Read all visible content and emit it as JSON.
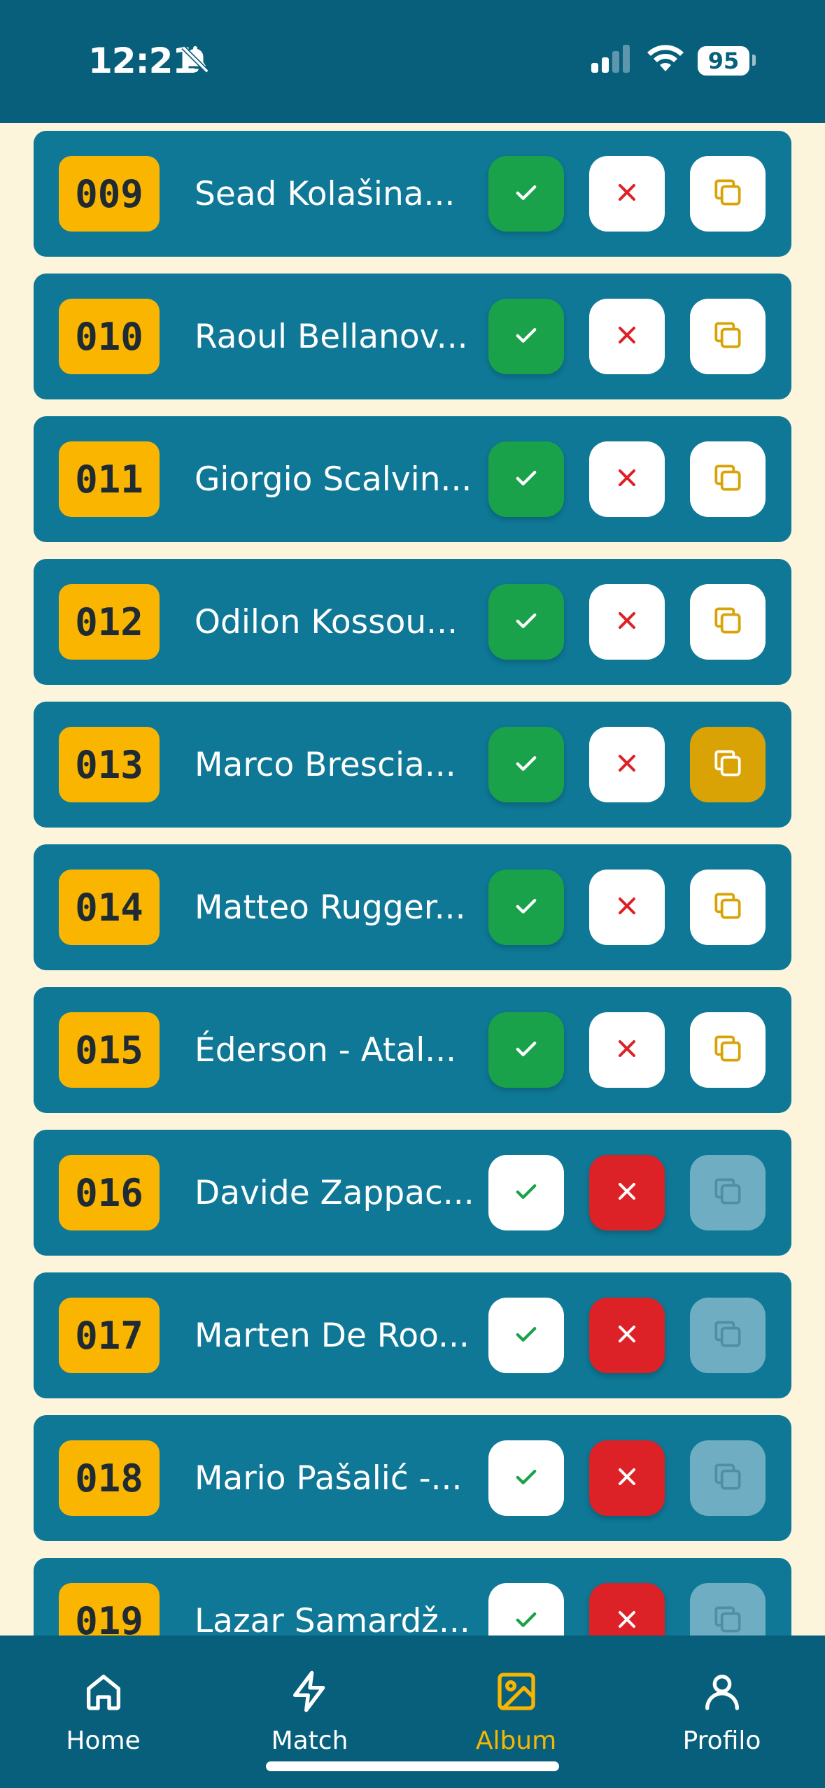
{
  "status_bar": {
    "time": "12:21",
    "battery": "95"
  },
  "stickers": [
    {
      "number": "009",
      "name": "Sead Kolašina...",
      "owned": true,
      "missing": false,
      "duplicate": "off"
    },
    {
      "number": "010",
      "name": "Raoul Bellanov...",
      "owned": true,
      "missing": false,
      "duplicate": "off"
    },
    {
      "number": "011",
      "name": "Giorgio Scalvin...",
      "owned": true,
      "missing": false,
      "duplicate": "off"
    },
    {
      "number": "012",
      "name": "Odilon Kossou...",
      "owned": true,
      "missing": false,
      "duplicate": "off"
    },
    {
      "number": "013",
      "name": "Marco Brescia...",
      "owned": true,
      "missing": false,
      "duplicate": "on"
    },
    {
      "number": "014",
      "name": "Matteo Rugger...",
      "owned": true,
      "missing": false,
      "duplicate": "off"
    },
    {
      "number": "015",
      "name": "Éderson - Atal...",
      "owned": true,
      "missing": false,
      "duplicate": "off"
    },
    {
      "number": "016",
      "name": "Davide Zappac...",
      "owned": false,
      "missing": true,
      "duplicate": "disabled"
    },
    {
      "number": "017",
      "name": "Marten De Roo...",
      "owned": false,
      "missing": true,
      "duplicate": "disabled"
    },
    {
      "number": "018",
      "name": "Mario Pašalić -...",
      "owned": false,
      "missing": true,
      "duplicate": "disabled"
    },
    {
      "number": "019",
      "name": "Lazar Samardž...",
      "owned": false,
      "missing": true,
      "duplicate": "disabled"
    }
  ],
  "tabs": [
    {
      "label": "Home",
      "icon": "home-icon",
      "active": false
    },
    {
      "label": "Match",
      "icon": "lightning-icon",
      "active": false
    },
    {
      "label": "Album",
      "icon": "image-icon",
      "active": true
    },
    {
      "label": "Profilo",
      "icon": "person-icon",
      "active": false
    }
  ],
  "colors": {
    "header": "#075F7C",
    "row": "#0E7896",
    "badge": "#F9B500",
    "owned": "#1AA24B",
    "missing": "#DC2127",
    "duplicate_active": "#D9A306",
    "background": "#FDF4DC"
  }
}
